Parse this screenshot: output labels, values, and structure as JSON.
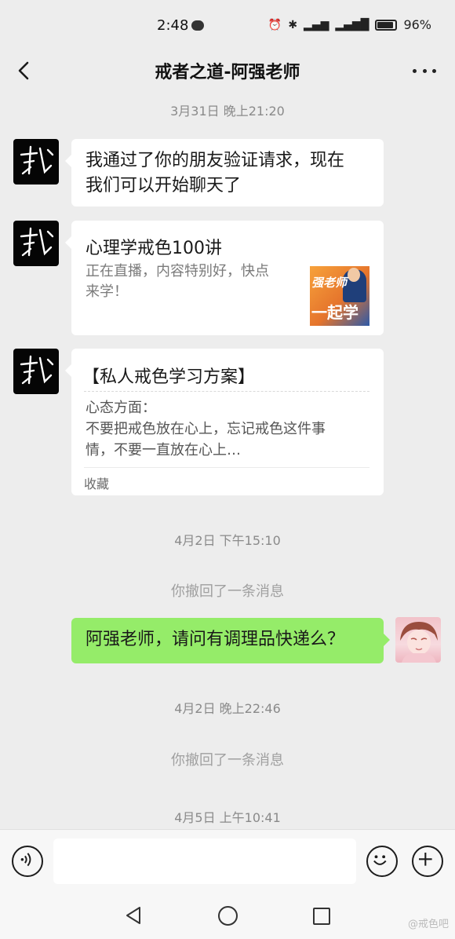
{
  "status_bar": {
    "time": "2:48",
    "battery": "96%",
    "icons": [
      "message-icon",
      "alarm-icon",
      "bluetooth-icon",
      "signal-icon",
      "signal-4g-icon",
      "battery-icon"
    ]
  },
  "header": {
    "title": "戒者之道-阿强老师",
    "back_icon": "chevron-left-icon",
    "more_icon": "more-dots-icon"
  },
  "messages": {
    "ts1": "3月31日 晚上21:20",
    "msg1": {
      "line1": "我通过了你的朋友验证请求，现在",
      "line2": "我们可以开始聊天了"
    },
    "card": {
      "title": "心理学戒色100讲",
      "desc_line1": "正在直播，内容特别好，快点",
      "desc_line2": "来学！",
      "thumb_text_top": "强老师",
      "thumb_text_bottom": "一起学"
    },
    "fav": {
      "title": "【私人戒色学习方案】",
      "line1": "心态方面：",
      "line2": "不要把戒色放在心上，忘记戒色这件事",
      "line3": "情，不要一直放在心上…",
      "footer": "收藏"
    },
    "ts2": "4月2日 下午15:10",
    "recall1": "你撤回了一条消息",
    "me_msg": "阿强老师，请问有调理品快递么？",
    "ts3": "4月2日 晚上22:46",
    "recall2": "你撤回了一条消息",
    "ts4": "4月5日 上午10:41"
  },
  "input_bar": {
    "voice_icon": "voice-icon",
    "input_value": "",
    "emoji_icon": "emoji-icon",
    "plus_icon": "plus-icon"
  },
  "system_nav": {
    "watermark": "@戒色吧"
  },
  "colors": {
    "background": "#ededed",
    "bubble_other": "#ffffff",
    "bubble_me": "#95ec69",
    "timestamp": "#8a8a8a"
  }
}
